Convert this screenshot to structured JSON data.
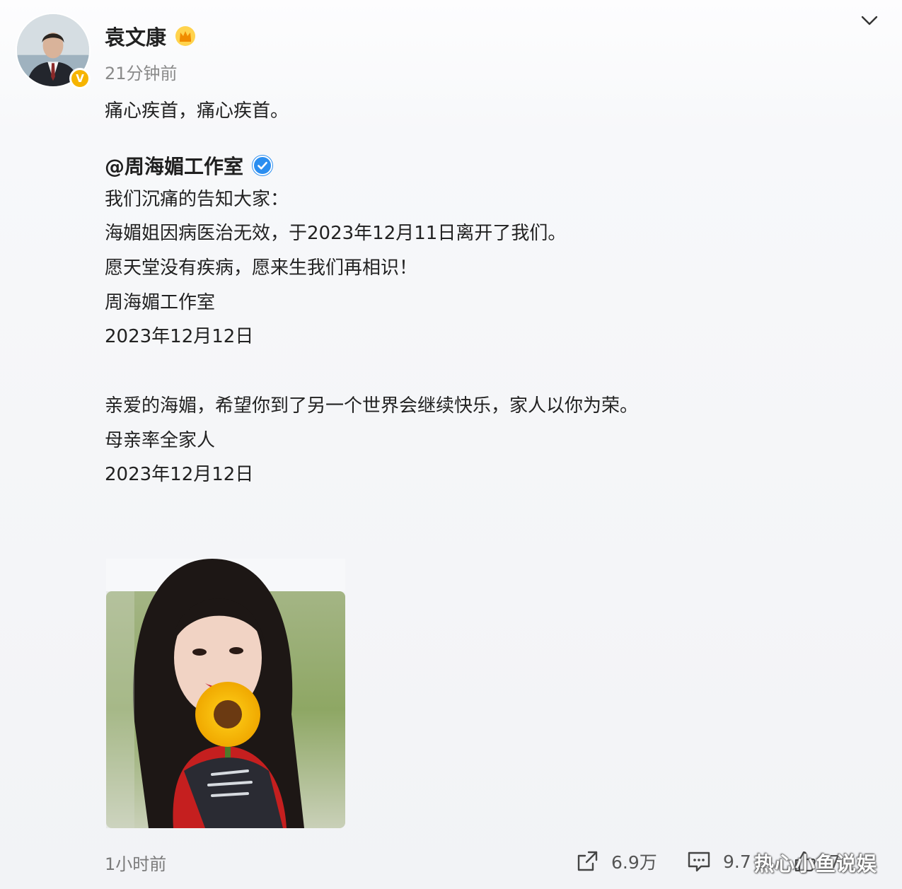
{
  "post": {
    "author": "袁文康",
    "posted_time": "21分钟前",
    "text": "痛心疾首，痛心疾首。",
    "repost": {
      "mention": "@周海媚工作室",
      "lines": [
        "我们沉痛的告知大家：",
        "海媚姐因病医治无效，于2023年12月11日离开了我们。",
        "愿天堂没有疾病，愿来生我们再相识！",
        "周海媚工作室",
        "2023年12月12日",
        "亲爱的海媚，希望你到了另一个世界会继续快乐，家人以你为荣。",
        "母亲率全家人",
        "2023年12月12日"
      ]
    },
    "footer_time": "1小时前",
    "actions": {
      "share_count": "6.9万",
      "comment_count": "9.7",
      "like_count": "7"
    },
    "watermark": "热心小鱼说娱"
  },
  "icons": {
    "crown": "crown-icon",
    "verified": "verified-icon",
    "chevron": "chevron-down-icon",
    "share": "share-icon",
    "comment": "comment-icon",
    "like": "like-icon"
  },
  "colors": {
    "verified_blue": "#2b8ef0",
    "badge_gold": "#f6b400",
    "text": "#222222",
    "muted": "#8a8a8a"
  }
}
